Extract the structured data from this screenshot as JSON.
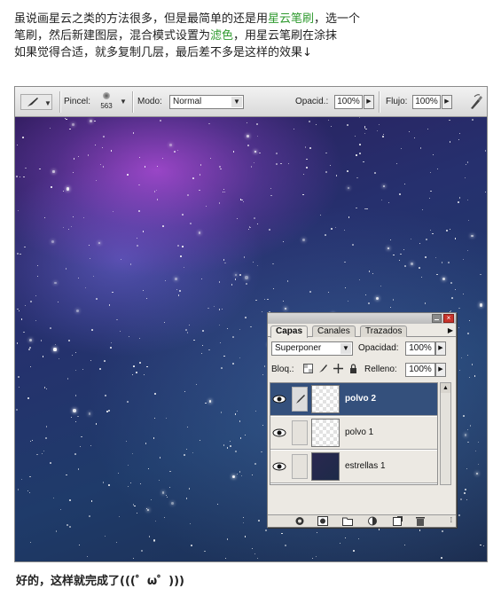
{
  "intro": {
    "line1_a": "虽说画星云之类的方法很多，但是最简单的还是用",
    "line1_hl": "星云笔刷",
    "line1_b": "，选一个",
    "line2_a": "笔刷，然后新建图层，混合模式设置为",
    "line2_hl": "滤色",
    "line2_b": "，用星云笔刷在涂抹",
    "line3": "如果觉得合适，就多复制几层，最后差不多是这样的效果↓"
  },
  "options_bar": {
    "pincel_label": "Pincel:",
    "brush_size": "563",
    "modo_label": "Modo:",
    "modo_value": "Normal",
    "opacidad_label": "Opacid.:",
    "opacidad_value": "100%",
    "flujo_label": "Flujo:",
    "flujo_value": "100%"
  },
  "layers_panel": {
    "tabs": [
      "Capas",
      "Canales",
      "Trazados"
    ],
    "active_tab": "Capas",
    "blend_mode": "Superponer",
    "opacity_label": "Opacidad:",
    "opacity_value": "100%",
    "lock_label": "Bloq.:",
    "fill_label": "Relleno:",
    "fill_value": "100%",
    "layers": [
      {
        "name": "polvo 2",
        "selected": true
      },
      {
        "name": "polvo 1",
        "selected": false
      },
      {
        "name": "estrellas 1",
        "selected": false
      }
    ]
  },
  "outro": "好的，这样就完成了(((゜ω゜)))",
  "colors": {
    "highlight": "#2f9a2f",
    "selected_layer": "#34507c",
    "close_button": "#c8332b"
  }
}
